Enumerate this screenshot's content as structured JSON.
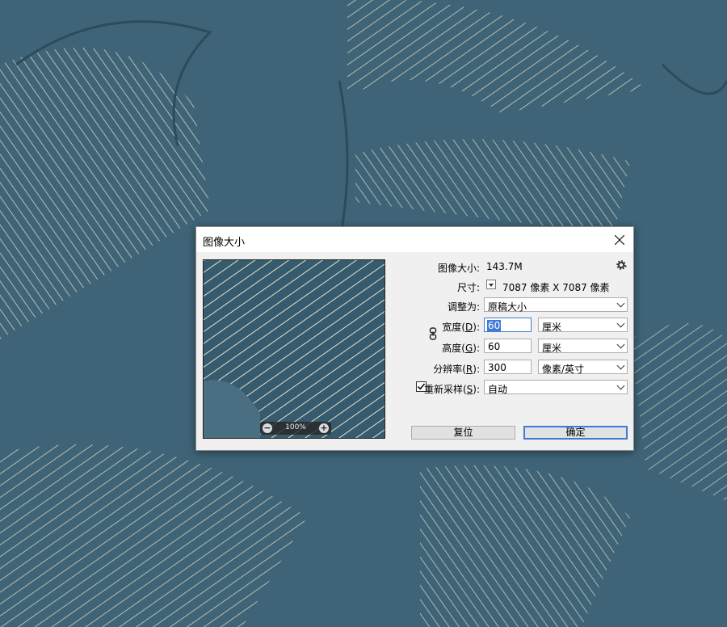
{
  "dialog": {
    "title": "图像大小",
    "image_size_label": "图像大小:",
    "image_size_value": "143.7M",
    "dimensions_label": "尺寸:",
    "dimensions_value": "7087 像素  X  7087 像素",
    "fit_to_label": "调整为:",
    "fit_to_value": "原稿大小",
    "width_label_pre": "宽度(",
    "width_label_key": "D",
    "width_label_post": "):",
    "width_value": "60",
    "width_unit": "厘米",
    "height_label_pre": "高度(",
    "height_label_key": "G",
    "height_label_post": "):",
    "height_value": "60",
    "height_unit": "厘米",
    "resolution_label_pre": "分辨率(",
    "resolution_label_key": "R",
    "resolution_label_post": "):",
    "resolution_value": "300",
    "resolution_unit": "像素/英寸",
    "resample_label_pre": "重新采样(",
    "resample_label_key": "S",
    "resample_label_post": "):",
    "resample_checked": true,
    "resample_value": "自动",
    "reset_button": "复位",
    "ok_button": "确定",
    "preview_zoom": "100%",
    "zoom_out_symbol": "−",
    "zoom_in_symbol": "+"
  },
  "icons": [
    "close-icon",
    "gear-icon",
    "link-chain-icon",
    "dropdown-arrow-icon",
    "zoom-out-icon",
    "zoom-in-icon",
    "checkmark-icon"
  ],
  "colors": {
    "background": "#3f6478",
    "pattern_lines": "#e8e2c4",
    "focus": "#3d7bd4"
  }
}
